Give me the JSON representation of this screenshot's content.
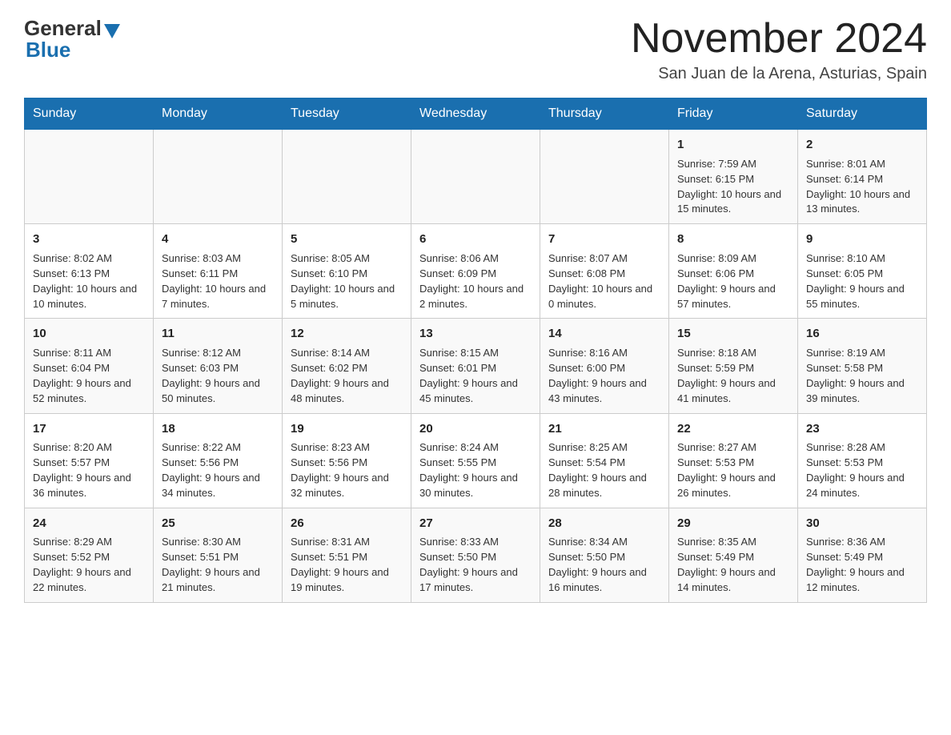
{
  "logo": {
    "general": "General",
    "blue": "Blue"
  },
  "title": "November 2024",
  "location": "San Juan de la Arena, Asturias, Spain",
  "days_of_week": [
    "Sunday",
    "Monday",
    "Tuesday",
    "Wednesday",
    "Thursday",
    "Friday",
    "Saturday"
  ],
  "weeks": [
    [
      {
        "day": "",
        "sunrise": "",
        "sunset": "",
        "daylight": ""
      },
      {
        "day": "",
        "sunrise": "",
        "sunset": "",
        "daylight": ""
      },
      {
        "day": "",
        "sunrise": "",
        "sunset": "",
        "daylight": ""
      },
      {
        "day": "",
        "sunrise": "",
        "sunset": "",
        "daylight": ""
      },
      {
        "day": "",
        "sunrise": "",
        "sunset": "",
        "daylight": ""
      },
      {
        "day": "1",
        "sunrise": "Sunrise: 7:59 AM",
        "sunset": "Sunset: 6:15 PM",
        "daylight": "Daylight: 10 hours and 15 minutes."
      },
      {
        "day": "2",
        "sunrise": "Sunrise: 8:01 AM",
        "sunset": "Sunset: 6:14 PM",
        "daylight": "Daylight: 10 hours and 13 minutes."
      }
    ],
    [
      {
        "day": "3",
        "sunrise": "Sunrise: 8:02 AM",
        "sunset": "Sunset: 6:13 PM",
        "daylight": "Daylight: 10 hours and 10 minutes."
      },
      {
        "day": "4",
        "sunrise": "Sunrise: 8:03 AM",
        "sunset": "Sunset: 6:11 PM",
        "daylight": "Daylight: 10 hours and 7 minutes."
      },
      {
        "day": "5",
        "sunrise": "Sunrise: 8:05 AM",
        "sunset": "Sunset: 6:10 PM",
        "daylight": "Daylight: 10 hours and 5 minutes."
      },
      {
        "day": "6",
        "sunrise": "Sunrise: 8:06 AM",
        "sunset": "Sunset: 6:09 PM",
        "daylight": "Daylight: 10 hours and 2 minutes."
      },
      {
        "day": "7",
        "sunrise": "Sunrise: 8:07 AM",
        "sunset": "Sunset: 6:08 PM",
        "daylight": "Daylight: 10 hours and 0 minutes."
      },
      {
        "day": "8",
        "sunrise": "Sunrise: 8:09 AM",
        "sunset": "Sunset: 6:06 PM",
        "daylight": "Daylight: 9 hours and 57 minutes."
      },
      {
        "day": "9",
        "sunrise": "Sunrise: 8:10 AM",
        "sunset": "Sunset: 6:05 PM",
        "daylight": "Daylight: 9 hours and 55 minutes."
      }
    ],
    [
      {
        "day": "10",
        "sunrise": "Sunrise: 8:11 AM",
        "sunset": "Sunset: 6:04 PM",
        "daylight": "Daylight: 9 hours and 52 minutes."
      },
      {
        "day": "11",
        "sunrise": "Sunrise: 8:12 AM",
        "sunset": "Sunset: 6:03 PM",
        "daylight": "Daylight: 9 hours and 50 minutes."
      },
      {
        "day": "12",
        "sunrise": "Sunrise: 8:14 AM",
        "sunset": "Sunset: 6:02 PM",
        "daylight": "Daylight: 9 hours and 48 minutes."
      },
      {
        "day": "13",
        "sunrise": "Sunrise: 8:15 AM",
        "sunset": "Sunset: 6:01 PM",
        "daylight": "Daylight: 9 hours and 45 minutes."
      },
      {
        "day": "14",
        "sunrise": "Sunrise: 8:16 AM",
        "sunset": "Sunset: 6:00 PM",
        "daylight": "Daylight: 9 hours and 43 minutes."
      },
      {
        "day": "15",
        "sunrise": "Sunrise: 8:18 AM",
        "sunset": "Sunset: 5:59 PM",
        "daylight": "Daylight: 9 hours and 41 minutes."
      },
      {
        "day": "16",
        "sunrise": "Sunrise: 8:19 AM",
        "sunset": "Sunset: 5:58 PM",
        "daylight": "Daylight: 9 hours and 39 minutes."
      }
    ],
    [
      {
        "day": "17",
        "sunrise": "Sunrise: 8:20 AM",
        "sunset": "Sunset: 5:57 PM",
        "daylight": "Daylight: 9 hours and 36 minutes."
      },
      {
        "day": "18",
        "sunrise": "Sunrise: 8:22 AM",
        "sunset": "Sunset: 5:56 PM",
        "daylight": "Daylight: 9 hours and 34 minutes."
      },
      {
        "day": "19",
        "sunrise": "Sunrise: 8:23 AM",
        "sunset": "Sunset: 5:56 PM",
        "daylight": "Daylight: 9 hours and 32 minutes."
      },
      {
        "day": "20",
        "sunrise": "Sunrise: 8:24 AM",
        "sunset": "Sunset: 5:55 PM",
        "daylight": "Daylight: 9 hours and 30 minutes."
      },
      {
        "day": "21",
        "sunrise": "Sunrise: 8:25 AM",
        "sunset": "Sunset: 5:54 PM",
        "daylight": "Daylight: 9 hours and 28 minutes."
      },
      {
        "day": "22",
        "sunrise": "Sunrise: 8:27 AM",
        "sunset": "Sunset: 5:53 PM",
        "daylight": "Daylight: 9 hours and 26 minutes."
      },
      {
        "day": "23",
        "sunrise": "Sunrise: 8:28 AM",
        "sunset": "Sunset: 5:53 PM",
        "daylight": "Daylight: 9 hours and 24 minutes."
      }
    ],
    [
      {
        "day": "24",
        "sunrise": "Sunrise: 8:29 AM",
        "sunset": "Sunset: 5:52 PM",
        "daylight": "Daylight: 9 hours and 22 minutes."
      },
      {
        "day": "25",
        "sunrise": "Sunrise: 8:30 AM",
        "sunset": "Sunset: 5:51 PM",
        "daylight": "Daylight: 9 hours and 21 minutes."
      },
      {
        "day": "26",
        "sunrise": "Sunrise: 8:31 AM",
        "sunset": "Sunset: 5:51 PM",
        "daylight": "Daylight: 9 hours and 19 minutes."
      },
      {
        "day": "27",
        "sunrise": "Sunrise: 8:33 AM",
        "sunset": "Sunset: 5:50 PM",
        "daylight": "Daylight: 9 hours and 17 minutes."
      },
      {
        "day": "28",
        "sunrise": "Sunrise: 8:34 AM",
        "sunset": "Sunset: 5:50 PM",
        "daylight": "Daylight: 9 hours and 16 minutes."
      },
      {
        "day": "29",
        "sunrise": "Sunrise: 8:35 AM",
        "sunset": "Sunset: 5:49 PM",
        "daylight": "Daylight: 9 hours and 14 minutes."
      },
      {
        "day": "30",
        "sunrise": "Sunrise: 8:36 AM",
        "sunset": "Sunset: 5:49 PM",
        "daylight": "Daylight: 9 hours and 12 minutes."
      }
    ]
  ]
}
